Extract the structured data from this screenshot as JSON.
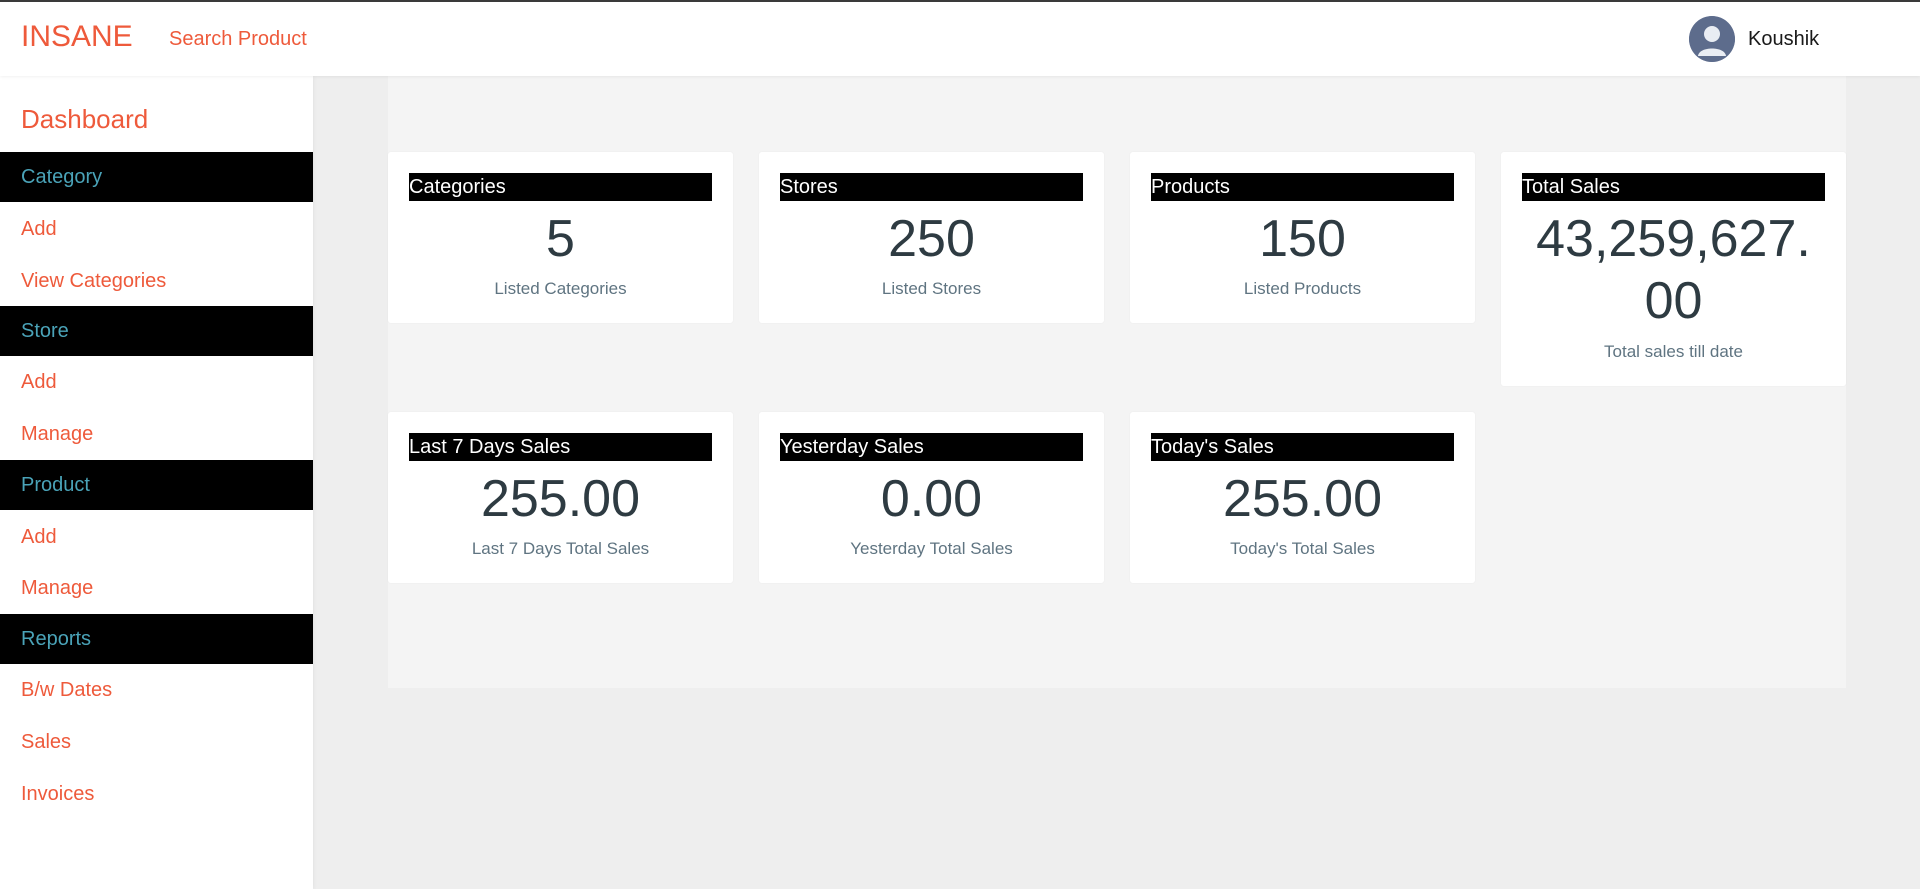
{
  "header": {
    "brand": "INSANE",
    "search_link": "Search Product",
    "user_name": "Koushik"
  },
  "sidebar": {
    "title": "Dashboard",
    "items": [
      {
        "label": "Category",
        "type": "header"
      },
      {
        "label": "Add",
        "type": "link"
      },
      {
        "label": "View Categories",
        "type": "link"
      },
      {
        "label": "Store",
        "type": "header"
      },
      {
        "label": "Add",
        "type": "link"
      },
      {
        "label": "Manage",
        "type": "link"
      },
      {
        "label": "Product",
        "type": "header"
      },
      {
        "label": "Add",
        "type": "link"
      },
      {
        "label": "Manage",
        "type": "link"
      },
      {
        "label": "Reports",
        "type": "header"
      },
      {
        "label": "B/w Dates",
        "type": "link"
      },
      {
        "label": "Sales",
        "type": "link"
      },
      {
        "label": "Invoices",
        "type": "link"
      }
    ]
  },
  "cards": [
    {
      "title": "Categories",
      "value": "5",
      "caption": "Listed Categories"
    },
    {
      "title": "Stores",
      "value": "250",
      "caption": "Listed Stores"
    },
    {
      "title": "Products",
      "value": "150",
      "caption": "Listed Products"
    },
    {
      "title": "Total Sales",
      "value_line1": "43,259,627.",
      "value_line2": "00",
      "caption": "Total sales till date"
    },
    {
      "title": "Last 7 Days Sales",
      "value": "255.00",
      "caption": "Last 7 Days Total Sales"
    },
    {
      "title": "Yesterday Sales",
      "value": "0.00",
      "caption": "Yesterday Total Sales"
    },
    {
      "title": "Today's Sales",
      "value": "255.00",
      "caption": "Today's Total Sales"
    }
  ],
  "colors": {
    "accent": "#ee5a3b",
    "sidebar_header_bg": "#000000",
    "sidebar_header_text": "#4aa3b8",
    "value_text": "#2e3b42",
    "caption_text": "#5f7481"
  },
  "icons": {
    "avatar": "user-avatar-icon"
  }
}
